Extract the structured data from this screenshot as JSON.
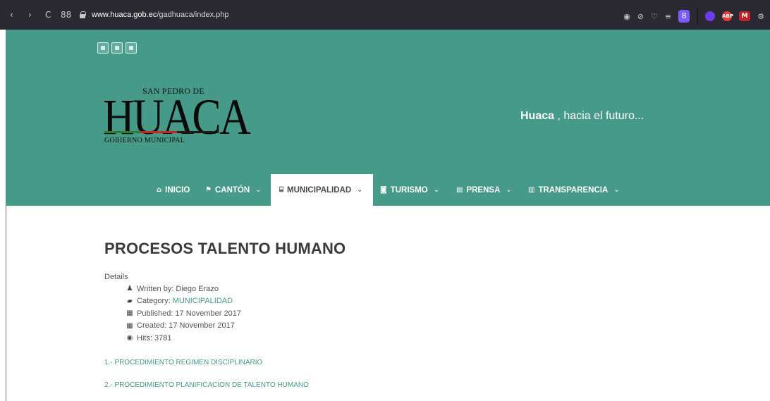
{
  "browser": {
    "back": "‹",
    "forward": "›",
    "reload": "C",
    "apps": "88",
    "url_domain": "www.huaca.gob.ec",
    "url_path": "/gadhuaca/index.php",
    "profile_letter": "8",
    "ext_abp": "ABP",
    "ext_m": "M"
  },
  "header": {
    "logo": {
      "top_text": "SAN PEDRO DE",
      "main_text": "HUACA",
      "bottom_text": "GOBIERNO MUNICIPAL",
      "bar_colors": [
        "#2e7d32",
        "#c62828",
        "#1b1b1b"
      ]
    },
    "tagline_bold": "Huaca",
    "tagline_rest": " , hacia el futuro..."
  },
  "menu": {
    "items": [
      {
        "icon": "home-icon",
        "glyph": "⌂",
        "label": "INICIO",
        "has_dropdown": false
      },
      {
        "icon": "flag-icon",
        "glyph": "⚑",
        "label": "CANTÓN",
        "has_dropdown": true
      },
      {
        "icon": "bank-icon",
        "glyph": "⌸",
        "label": "MUNICIPALIDAD",
        "has_dropdown": true,
        "active": true
      },
      {
        "icon": "camera-icon",
        "glyph": "◙",
        "label": "TURISMO",
        "has_dropdown": true
      },
      {
        "icon": "newspaper-icon",
        "glyph": "▤",
        "label": "PRENSA",
        "has_dropdown": true
      },
      {
        "icon": "book-icon",
        "glyph": "▥",
        "label": "TRANSPARENCIA",
        "has_dropdown": true
      }
    ],
    "chevron": "⌄"
  },
  "article": {
    "title": "PROCESOS TALENTO HUMANO",
    "details_label": "Details",
    "meta": {
      "author_label": "Written by: Diego Erazo",
      "category_label": "Category:",
      "category_value": "MUNICIPALIDAD",
      "published_label": "Published: 17 November 2017",
      "created_label": "Created: 17 November 2017",
      "hits_label": "Hits: 3781"
    },
    "links": [
      "1.- PROCEDIMIENTO REGIMEN DISCIPLINARIO",
      "2.- PROCEDIMIENTO PLANIFICACION DE TALENTO HUMANO"
    ]
  },
  "colors": {
    "header_green": "#459b88",
    "link_green": "#459b88",
    "title_gray": "#3b3b3b"
  }
}
